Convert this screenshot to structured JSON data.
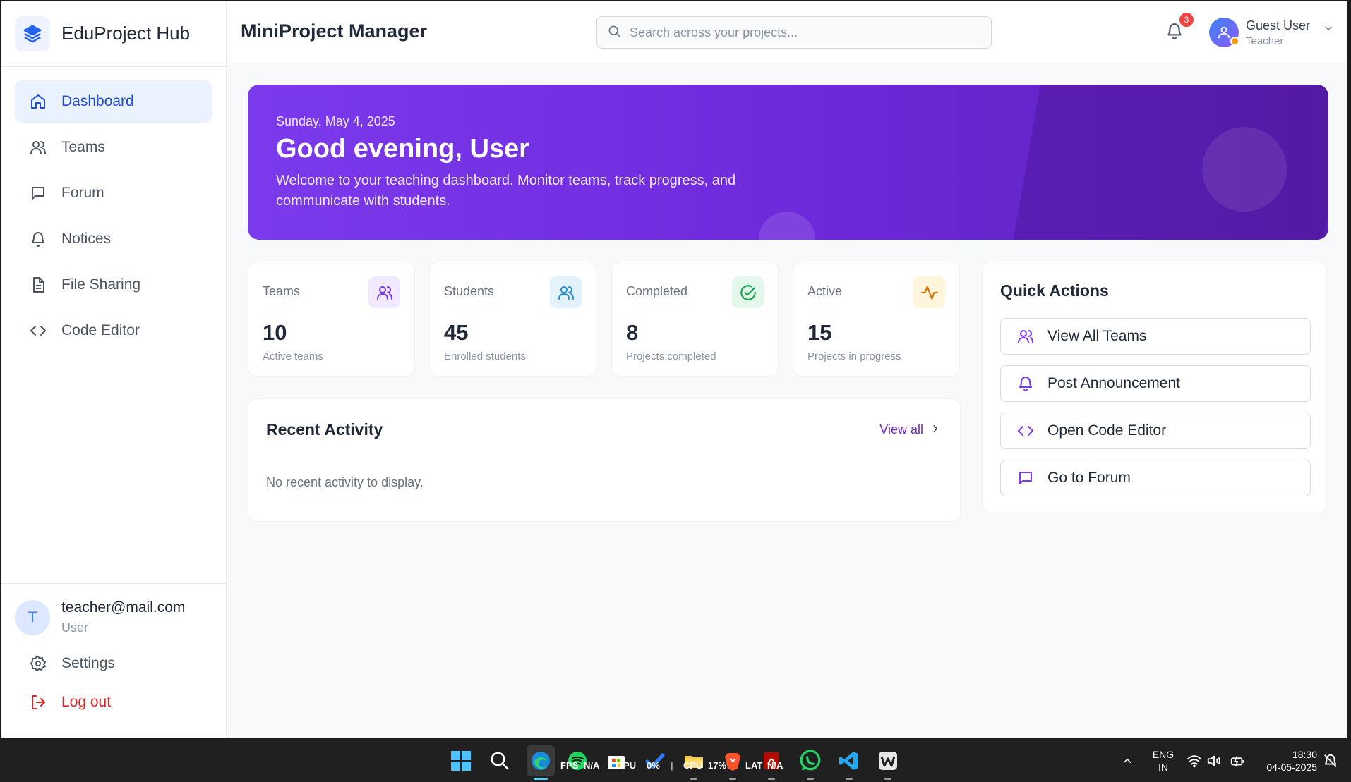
{
  "sidebar": {
    "brand": "EduProject Hub",
    "nav": [
      {
        "label": "Dashboard",
        "icon": "home-icon",
        "active": true
      },
      {
        "label": "Teams",
        "icon": "users-icon"
      },
      {
        "label": "Forum",
        "icon": "message-square-icon"
      },
      {
        "label": "Notices",
        "icon": "bell-icon"
      },
      {
        "label": "File Sharing",
        "icon": "file-icon"
      },
      {
        "label": "Code Editor",
        "icon": "code-icon"
      }
    ],
    "user": {
      "initial": "T",
      "email": "teacher@mail.com",
      "role": "User"
    },
    "settings_label": "Settings",
    "logout_label": "Log out"
  },
  "header": {
    "title": "MiniProject Manager",
    "search_placeholder": "Search across your projects...",
    "notification_count": "3",
    "profile": {
      "name": "Guest User",
      "role": "Teacher"
    }
  },
  "hero": {
    "date": "Sunday, May 4, 2025",
    "greeting": "Good evening, User",
    "subtitle": "Welcome to your teaching dashboard. Monitor teams, track progress, and communicate with students."
  },
  "stats": [
    {
      "label": "Teams",
      "value": "10",
      "sub": "Active teams",
      "icon": "users-icon",
      "color": "#7c3aed",
      "bg": "#f1e9ff"
    },
    {
      "label": "Students",
      "value": "45",
      "sub": "Enrolled students",
      "icon": "users-icon",
      "color": "#1d8fd8",
      "bg": "#e3f2fd"
    },
    {
      "label": "Completed",
      "value": "8",
      "sub": "Projects completed",
      "icon": "check-circle-icon",
      "color": "#16a34a",
      "bg": "#e3f8ea"
    },
    {
      "label": "Active",
      "value": "15",
      "sub": "Projects in progress",
      "icon": "activity-icon",
      "color": "#d97706",
      "bg": "#fff4dc"
    }
  ],
  "recent": {
    "title": "Recent Activity",
    "view_all": "View all",
    "empty": "No recent activity to display."
  },
  "quick": {
    "title": "Quick Actions",
    "actions": [
      {
        "label": "View All Teams",
        "icon": "users-icon"
      },
      {
        "label": "Post Announcement",
        "icon": "bell-icon"
      },
      {
        "label": "Open Code Editor",
        "icon": "code-icon"
      },
      {
        "label": "Go to Forum",
        "icon": "message-square-icon"
      }
    ]
  },
  "taskbar": {
    "overlay": {
      "fps": "FPS",
      "fps_val": "N/A",
      "gpu": "GPU",
      "gpu_val": "0%",
      "cpu": "CPU",
      "cpu_val": "17%",
      "lat": "LAT",
      "lat_val": "N/A"
    },
    "lang": "ENG",
    "region": "IN",
    "time": "18:30",
    "date": "04-05-2025"
  },
  "colors": {
    "accent": "#6d28d9",
    "primary": "#1d4ed8",
    "danger": "#dc2626"
  }
}
